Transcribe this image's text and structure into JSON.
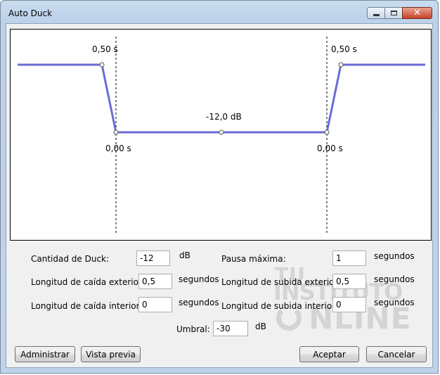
{
  "window": {
    "title": "Auto Duck"
  },
  "graph": {
    "outer_fade_down_label": "0,50 s",
    "inner_fade_down_label": "0,00 s",
    "duck_amount_label": "-12,0 dB",
    "inner_fade_up_label": "0,00 s",
    "outer_fade_up_label": "0,50 s",
    "line_color": "#6b6bd6"
  },
  "form": {
    "duck_amount": {
      "label": "Cantidad de Duck:",
      "value": "-12",
      "unit": "dB"
    },
    "outer_fade_down": {
      "label": "Longitud de caída exterior:",
      "value": "0,5",
      "unit": "segundos"
    },
    "inner_fade_down": {
      "label": "Longitud de caída interior:",
      "value": "0",
      "unit": "segundos"
    },
    "max_pause": {
      "label": "Pausa máxima:",
      "value": "1",
      "unit": "segundos"
    },
    "outer_fade_up": {
      "label": "Longitud de subida exterior:",
      "value": "0,5",
      "unit": "segundos"
    },
    "inner_fade_up": {
      "label": "Longitud de subida interior:",
      "value": "0",
      "unit": "segundos"
    },
    "threshold": {
      "label": "Umbral:",
      "value": "-30",
      "unit": "dB"
    }
  },
  "buttons": {
    "manage": "Administrar",
    "preview": "Vista previa",
    "ok": "Aceptar",
    "cancel": "Cancelar"
  },
  "watermark": {
    "line1": "TU",
    "line2": "INSTITUTO",
    "line3": "NLINE"
  }
}
